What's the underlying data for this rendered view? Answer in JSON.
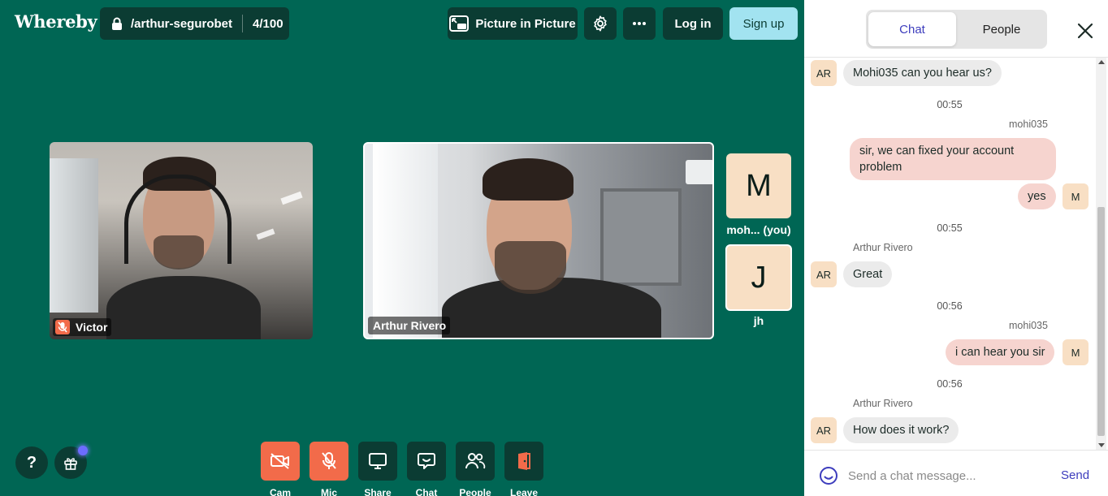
{
  "app": {
    "logo": "Whereby"
  },
  "room": {
    "name": "/arthur-segurobet",
    "count": "4/100"
  },
  "toolbar": {
    "pip_label": "Picture in Picture",
    "login_label": "Log in",
    "signup_label": "Sign up"
  },
  "participants": [
    {
      "name": "Victor",
      "muted": true
    },
    {
      "name": "Arthur Rivero",
      "muted": false
    },
    {
      "initial": "M",
      "label": "moh... (you)"
    },
    {
      "initial": "J",
      "label": "jh"
    }
  ],
  "controls": [
    {
      "label": "Cam",
      "state": "off",
      "color": "#f26b4a"
    },
    {
      "label": "Mic",
      "state": "off",
      "color": "#f26b4a"
    },
    {
      "label": "Share"
    },
    {
      "label": "Chat"
    },
    {
      "label": "People"
    },
    {
      "label": "Leave"
    }
  ],
  "help_label": "?",
  "panel": {
    "tabs": [
      {
        "label": "Chat",
        "active": true
      },
      {
        "label": "People",
        "active": false
      }
    ],
    "messages": [
      {
        "avatar": "AR",
        "text": "Mohi035 can you hear us?"
      },
      {
        "timestamp": "00:55",
        "sender": "mohi035",
        "text_lines": [
          "sir, we can fixed your account",
          "problem"
        ]
      },
      {
        "avatar": "M",
        "text": "yes"
      },
      {
        "timestamp": "00:55",
        "sender": "Arthur Rivero",
        "avatar": "AR",
        "text": "Great"
      },
      {
        "timestamp": "00:56",
        "sender": "mohi035",
        "avatar": "M",
        "text": "i can hear you sir"
      },
      {
        "timestamp": "00:56",
        "sender": "Arthur Rivero",
        "avatar": "AR",
        "text": "How does it work?"
      }
    ],
    "composer": {
      "placeholder": "Send a chat message...",
      "send_label": "Send"
    }
  },
  "colors": {
    "background": "#006654",
    "dark_button": "#0b3c33",
    "accent_red": "#f26b4a",
    "signup": "#a2e3f0",
    "avatar_bg": "#f8dfc4",
    "chat_accent": "#3d3dbd"
  }
}
